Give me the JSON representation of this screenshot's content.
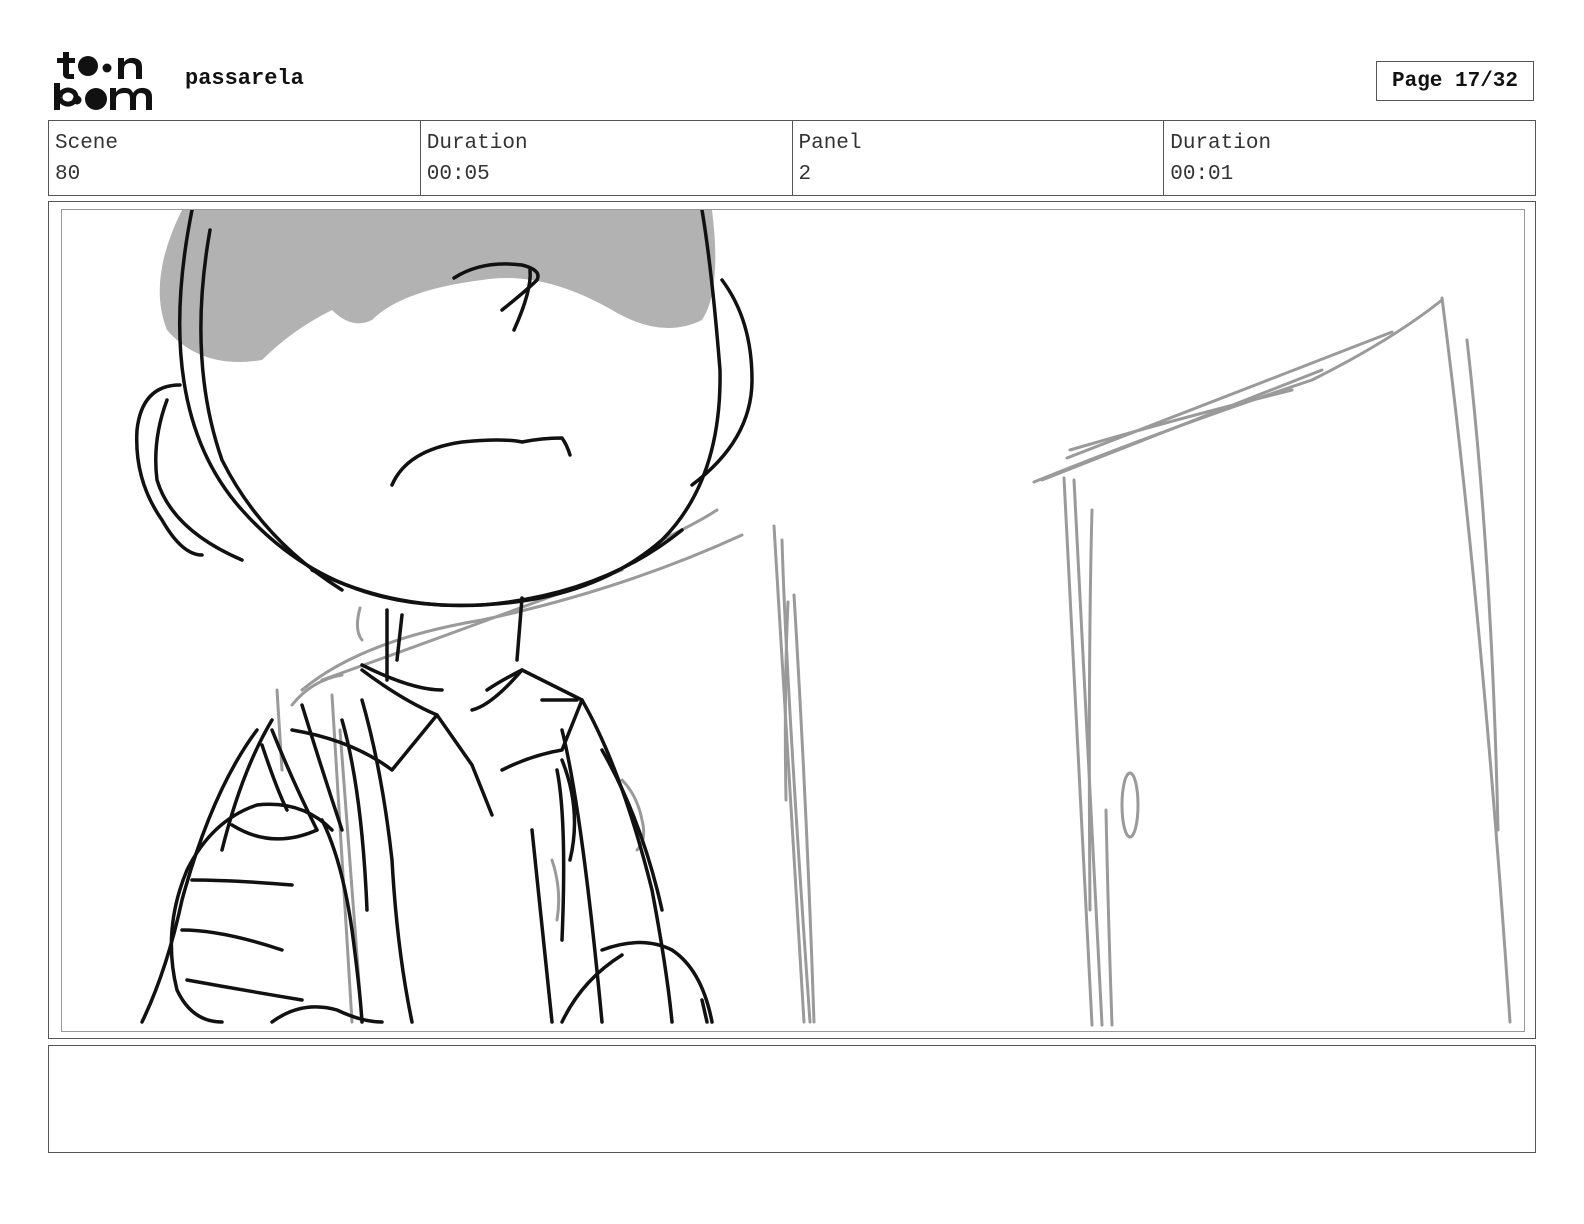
{
  "header": {
    "logo_text": "toon boom",
    "project_name": "passarela",
    "page_label": "Page 17/32"
  },
  "info": [
    {
      "label": "Scene",
      "value": "80"
    },
    {
      "label": "Duration",
      "value": "00:05"
    },
    {
      "label": "Panel",
      "value": "2"
    },
    {
      "label": "Duration",
      "value": "00:01"
    }
  ],
  "notes": {
    "text": ""
  },
  "colors": {
    "ink": "#111111",
    "sketch_gray": "#9a9a9a",
    "shade_gray": "#b2b2b2",
    "frame_border": "#555555"
  }
}
